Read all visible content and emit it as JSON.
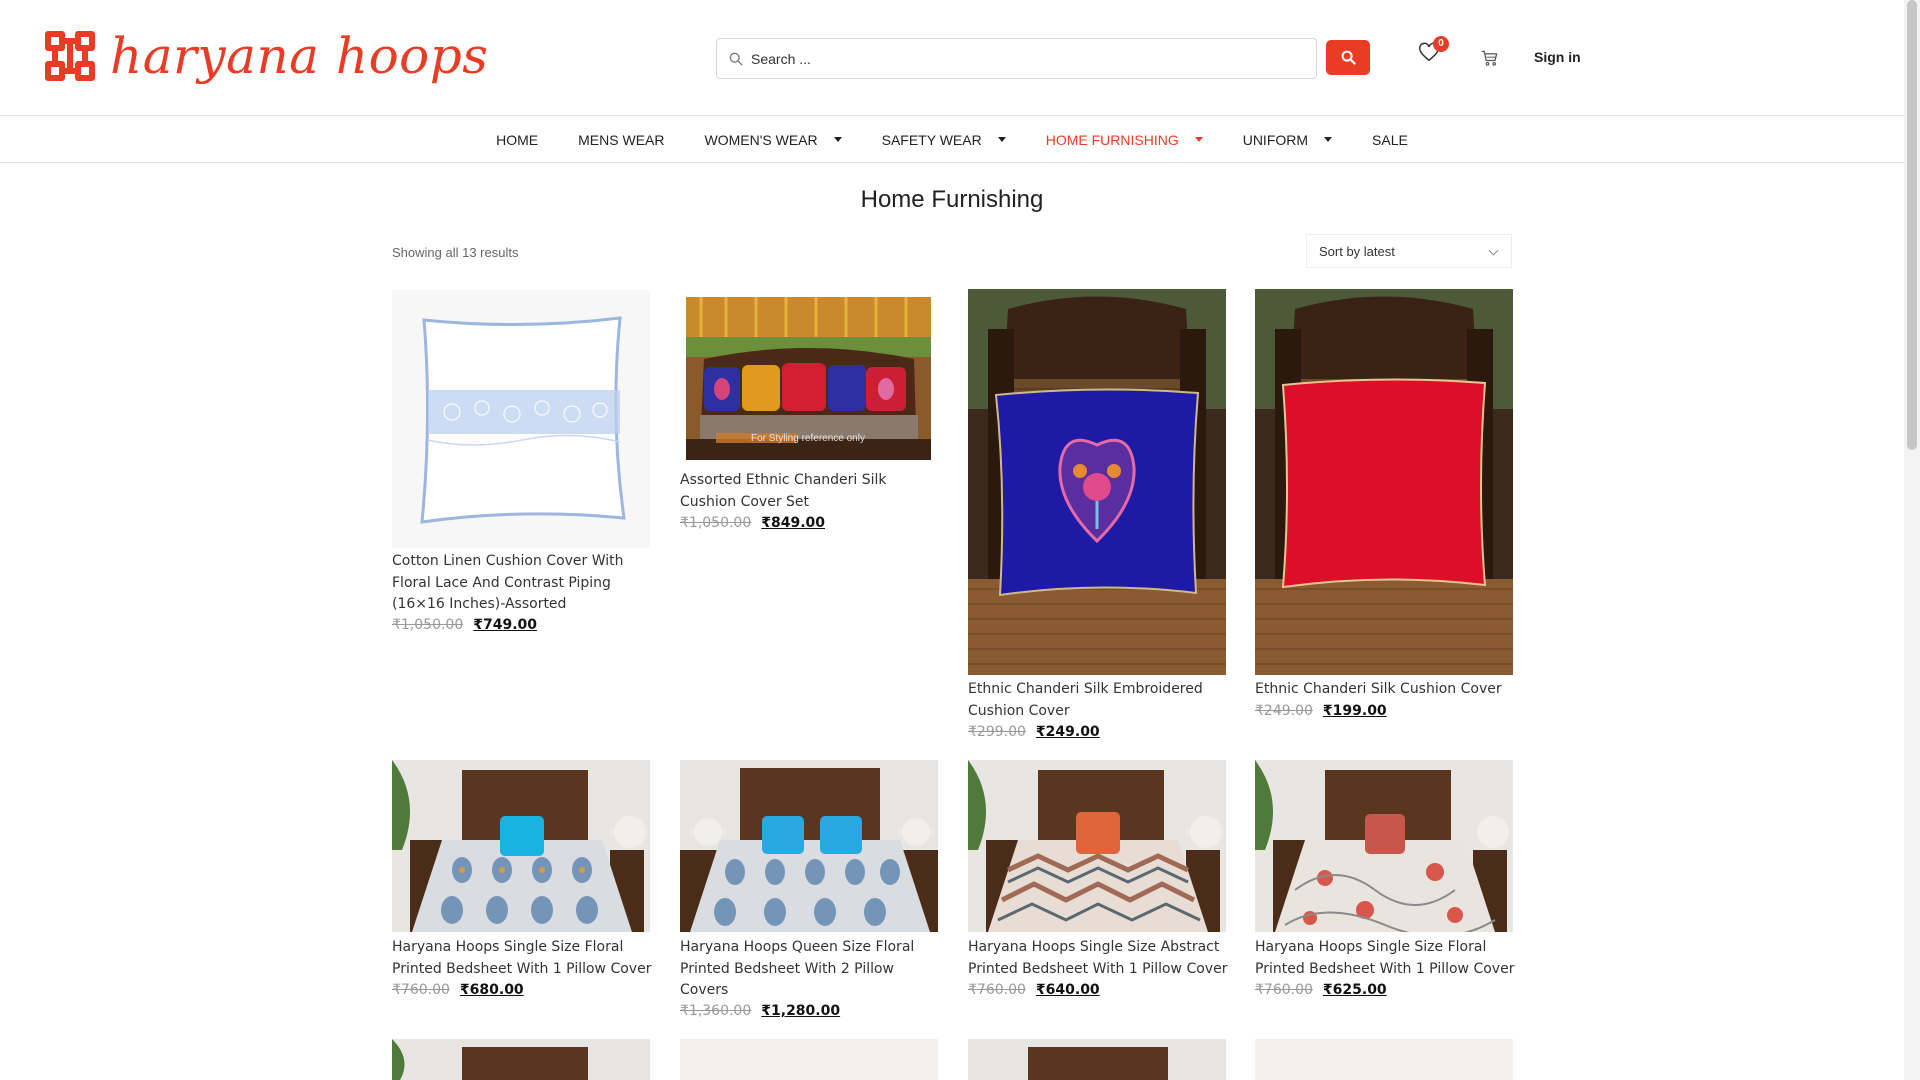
{
  "brand": {
    "name": "haryana hoops",
    "color": "#ea3b24"
  },
  "search": {
    "placeholder": "Search ..."
  },
  "header": {
    "wishlist_count": "0",
    "signin_label": "Sign in"
  },
  "nav": [
    {
      "label": "HOME",
      "dropdown": false,
      "active": false
    },
    {
      "label": "MENS WEAR",
      "dropdown": false,
      "active": false
    },
    {
      "label": "WOMEN'S WEAR",
      "dropdown": true,
      "active": false
    },
    {
      "label": "SAFETY WEAR",
      "dropdown": true,
      "active": false
    },
    {
      "label": "HOME FURNISHING",
      "dropdown": true,
      "active": true
    },
    {
      "label": "UNIFORM",
      "dropdown": true,
      "active": false
    },
    {
      "label": "SALE",
      "dropdown": false,
      "active": false
    }
  ],
  "page": {
    "title": "Home Furnishing",
    "result_count": "Showing all 13 results",
    "sort_label": "Sort by latest"
  },
  "products": [
    {
      "title": "Cotton Linen Cushion Cover With Floral Lace And Contrast Piping (16×16 Inches)-Assorted",
      "old_price": "₹1,050.00",
      "price": "₹749.00",
      "image": "white-cushion"
    },
    {
      "title": "Assorted Ethnic Chanderi Silk Cushion Cover Set",
      "old_price": "₹1,050.00",
      "price": "₹849.00",
      "image": "sofa-cushions",
      "image_caption": "For Styling reference only"
    },
    {
      "title": "Ethnic Chanderi Silk Embroidered Cushion Cover",
      "old_price": "₹299.00",
      "price": "₹249.00",
      "image": "blue-cushion-chair"
    },
    {
      "title": "Ethnic Chanderi Silk Cushion Cover",
      "old_price": "₹249.00",
      "price": "₹199.00",
      "image": "red-cushion-chair"
    },
    {
      "title": "Haryana Hoops Single Size Floral Printed Bedsheet With 1 Pillow Cover",
      "old_price": "₹760.00",
      "price": "₹680.00",
      "image": "bed-blue-pattern"
    },
    {
      "title": "Haryana Hoops Queen Size Floral Printed Bedsheet With 2 Pillow Covers",
      "old_price": "₹1,360.00",
      "price": "₹1,280.00",
      "image": "bed-blue-pattern-queen"
    },
    {
      "title": "Haryana Hoops Single Size Abstract Printed Bedsheet With 1 Pillow Cover",
      "old_price": "₹760.00",
      "price": "₹640.00",
      "image": "bed-chevron"
    },
    {
      "title": "Haryana Hoops Single Size Floral Printed Bedsheet With 1 Pillow Cover",
      "old_price": "₹760.00",
      "price": "₹625.00",
      "image": "bed-red-floral"
    }
  ]
}
